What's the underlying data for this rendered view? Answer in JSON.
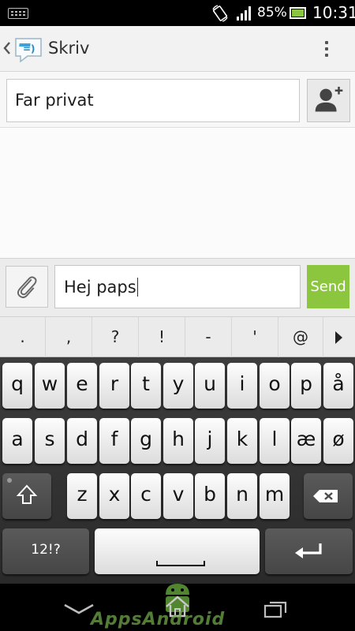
{
  "status_bar": {
    "battery_percent": "85%",
    "time": "10:31",
    "icons": [
      "keyboard-icon",
      "rotate-icon",
      "signal-icon",
      "battery-icon"
    ]
  },
  "action_bar": {
    "title": "Skriv",
    "icons": [
      "back-chevron-icon",
      "messaging-app-icon",
      "overflow-menu-icon"
    ]
  },
  "recipient": {
    "value": "Far privat",
    "add_contact_icon": "add-contact-icon"
  },
  "compose": {
    "message_value": "Hej paps",
    "send_label": "Send",
    "attach_icon": "paperclip-icon",
    "send_color": "#8cc63e"
  },
  "suggestions": [
    ".",
    ",",
    "?",
    "!",
    "-",
    "'",
    "@"
  ],
  "keyboard": {
    "row1": [
      "q",
      "w",
      "e",
      "r",
      "t",
      "y",
      "u",
      "i",
      "o",
      "p",
      "å"
    ],
    "row2": [
      "a",
      "s",
      "d",
      "f",
      "g",
      "h",
      "j",
      "k",
      "l",
      "æ",
      "ø"
    ],
    "row3": [
      "z",
      "x",
      "c",
      "v",
      "b",
      "n",
      "m"
    ],
    "symbols_label": "12!?",
    "special_icons": [
      "shift-icon",
      "backspace-icon",
      "space-icon",
      "enter-icon"
    ]
  },
  "nav_bar": {
    "icons": [
      "nav-back-icon",
      "nav-home-icon",
      "nav-recent-apps-icon"
    ],
    "watermark_text": "AppsAndroid"
  }
}
